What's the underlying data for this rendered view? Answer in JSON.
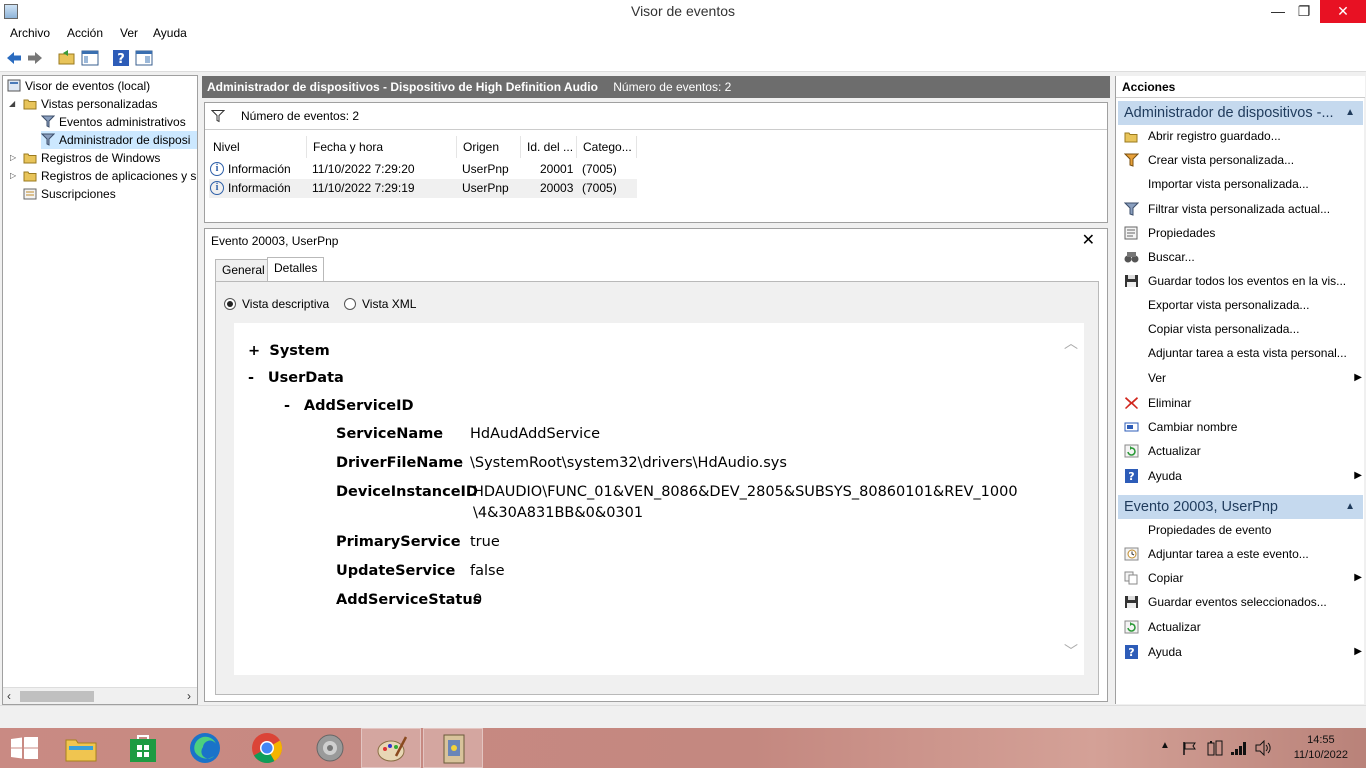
{
  "window": {
    "title": "Visor de eventos",
    "minimize": "—",
    "maximize": "❐",
    "close": "✕"
  },
  "menu": [
    "Archivo",
    "Acción",
    "Ver",
    "Ayuda"
  ],
  "tree": {
    "root": "Visor de eventos (local)",
    "custom_views": "Vistas personalizadas",
    "admin_events": "Eventos administrativos",
    "device_manager": "Administrador de disposi",
    "windows_logs": "Registros de Windows",
    "app_logs": "Registros de aplicaciones y s",
    "subscriptions": "Suscripciones"
  },
  "center": {
    "header_title": "Administrador de dispositivos - Dispositivo de High Definition Audio",
    "header_count": "Número de eventos: 2",
    "filter_text": "Número de eventos: 2",
    "columns": [
      "Nivel",
      "Fecha y hora",
      "Origen",
      "Id. del ...",
      "Catego..."
    ],
    "rows": [
      {
        "level": "Información",
        "datetime": "11/10/2022 7:29:20",
        "source": "UserPnp",
        "id": "20001",
        "category": "(7005)"
      },
      {
        "level": "Información",
        "datetime": "11/10/2022 7:29:19",
        "source": "UserPnp",
        "id": "20003",
        "category": "(7005)"
      }
    ]
  },
  "detail": {
    "title": "Evento 20003, UserPnp",
    "close": "✕",
    "tabs": [
      "General",
      "Detalles"
    ],
    "radio_friendly": "Vista descriptiva",
    "radio_xml": "Vista XML",
    "tree": {
      "system_toggle": "+",
      "system": "System",
      "userdata_toggle": "-",
      "userdata": "UserData",
      "addservice_toggle": "-",
      "addservice": "AddServiceID",
      "fields": [
        {
          "key": "ServiceName",
          "value": "HdAudAddService"
        },
        {
          "key": "DriverFileName",
          "value": "\\SystemRoot\\system32\\drivers\\HdAudio.sys"
        },
        {
          "key": "DeviceInstanceID",
          "value": "HDAUDIO\\FUNC_01&VEN_8086&DEV_2805&SUBSYS_80860101&REV_1000",
          "value2": "\\4&30A831BB&0&0301"
        },
        {
          "key": "PrimaryService",
          "value": "true"
        },
        {
          "key": "UpdateService",
          "value": "false"
        },
        {
          "key": "AddServiceStatus",
          "value": "0"
        }
      ]
    }
  },
  "actions": {
    "title": "Acciones",
    "section1": "Administrador de dispositivos -...",
    "items1": [
      "Abrir registro guardado...",
      "Crear vista personalizada...",
      "Importar vista personalizada...",
      "Filtrar vista personalizada actual...",
      "Propiedades",
      "Buscar...",
      "Guardar todos los eventos en la vis...",
      "Exportar vista personalizada...",
      "Copiar vista personalizada...",
      "Adjuntar tarea a esta vista personal...",
      "Ver",
      "Eliminar",
      "Cambiar nombre",
      "Actualizar",
      "Ayuda"
    ],
    "section2": "Evento 20003, UserPnp",
    "items2": [
      "Propiedades de evento",
      "Adjuntar tarea a este evento...",
      "Copiar",
      "Guardar eventos seleccionados...",
      "Actualizar",
      "Ayuda"
    ]
  },
  "taskbar": {
    "clock_time": "14:55",
    "clock_date": "11/10/2022"
  }
}
